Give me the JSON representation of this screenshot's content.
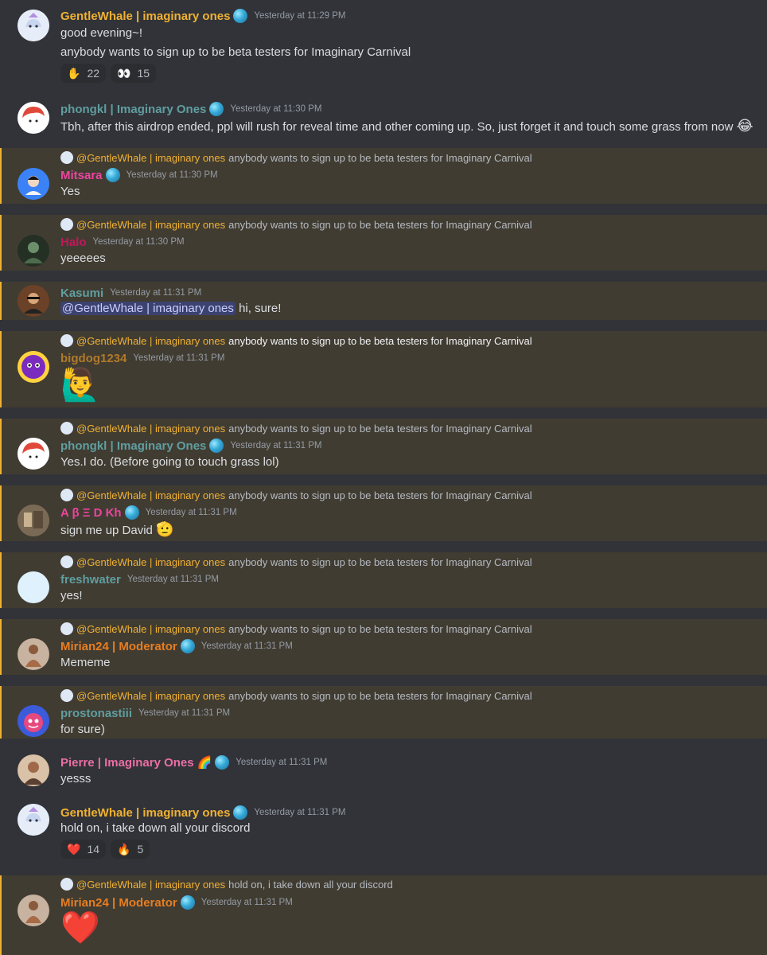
{
  "messages": [
    {
      "author": "GentleWhale | imaginary ones",
      "timestamp": "Yesterday at 11:29 PM",
      "lines": [
        "good evening~!",
        "anybody wants to sign up to be beta testers for Imaginary Carnival"
      ],
      "reactions": [
        {
          "emoji": "✋",
          "count": "22"
        },
        {
          "emoji": "👀",
          "count": "15"
        }
      ]
    },
    {
      "author": "phongkl | Imaginary Ones",
      "timestamp": "Yesterday at 11:30 PM",
      "text": "Tbh, after this airdrop ended, ppl will rush for reveal time and other coming up. So, just forget it and touch some grass from now",
      "emoji": "😂"
    },
    {
      "reply_to": "@GentleWhale | imaginary ones",
      "reply_text": "anybody wants to sign up to be beta testers for Imaginary Carnival",
      "author": "Mitsara",
      "timestamp": "Yesterday at 11:30 PM",
      "text": "Yes"
    },
    {
      "reply_to": "@GentleWhale | imaginary ones",
      "reply_text": "anybody wants to sign up to be beta testers for Imaginary Carnival",
      "author": "Halo",
      "timestamp": "Yesterday at 11:30 PM",
      "text": "yeeeees"
    },
    {
      "author": "Kasumi",
      "timestamp": "Yesterday at 11:31 PM",
      "mention": "@GentleWhale | imaginary ones",
      "text": "hi, sure!"
    },
    {
      "reply_to": "@GentleWhale | imaginary ones",
      "reply_text": "anybody wants to sign up to be beta testers for Imaginary Carnival",
      "author": "bigdog1234",
      "timestamp": "Yesterday at 11:31 PM",
      "big_emoji": "🙋‍♂️"
    },
    {
      "reply_to": "@GentleWhale | imaginary ones",
      "reply_text": "anybody wants to sign up to be beta testers for Imaginary Carnival",
      "author": "phongkl | Imaginary Ones",
      "timestamp": "Yesterday at 11:31 PM",
      "text": "Yes.I do. (Before going to touch grass lol)"
    },
    {
      "reply_to": "@GentleWhale | imaginary ones",
      "reply_text": "anybody wants to sign up to be beta testers for Imaginary Carnival",
      "author": "A β Ξ D Kh",
      "timestamp": "Yesterday at 11:31 PM",
      "text": "sign me up David",
      "emoji": "🫡"
    },
    {
      "reply_to": "@GentleWhale | imaginary ones",
      "reply_text": "anybody wants to sign up to be beta testers for Imaginary Carnival",
      "author": "freshwater",
      "timestamp": "Yesterday at 11:31 PM",
      "text": "yes!"
    },
    {
      "reply_to": "@GentleWhale | imaginary ones",
      "reply_text": "anybody wants to sign up to be beta testers for Imaginary Carnival",
      "author": "Mirian24 | Moderator",
      "timestamp": "Yesterday at 11:31 PM",
      "text": "Mememe"
    },
    {
      "reply_to": "@GentleWhale | imaginary ones",
      "reply_text": "anybody wants to sign up to be beta testers for Imaginary Carnival",
      "author": "prostonastiii",
      "timestamp": "Yesterday at 11:31 PM",
      "text": "for sure)"
    },
    {
      "author": "Pierre | Imaginary Ones",
      "author_emoji": "🌈",
      "timestamp": "Yesterday at 11:31 PM",
      "text": "yesss"
    },
    {
      "author": "GentleWhale | imaginary ones",
      "timestamp": "Yesterday at 11:31 PM",
      "text": "hold on, i take down all your discord",
      "reactions": [
        {
          "emoji": "❤️",
          "count": "14"
        },
        {
          "emoji": "🔥",
          "count": "5"
        }
      ]
    },
    {
      "reply_to": "@GentleWhale | imaginary ones",
      "reply_text": "hold on, i take down all your discord",
      "author": "Mirian24 | Moderator",
      "timestamp": "Yesterday at 11:31 PM",
      "big_emoji": "❤️"
    }
  ],
  "colors": {
    "background": "#313338",
    "highlight": "#413c32",
    "highlight_bar": "#f0b132",
    "gentlewhale": "#f0b132",
    "teal_name": "#5f9ea0",
    "pink_name": "#eb459e",
    "orange_name": "#e67e22",
    "mention_bg": "#3c4270"
  }
}
